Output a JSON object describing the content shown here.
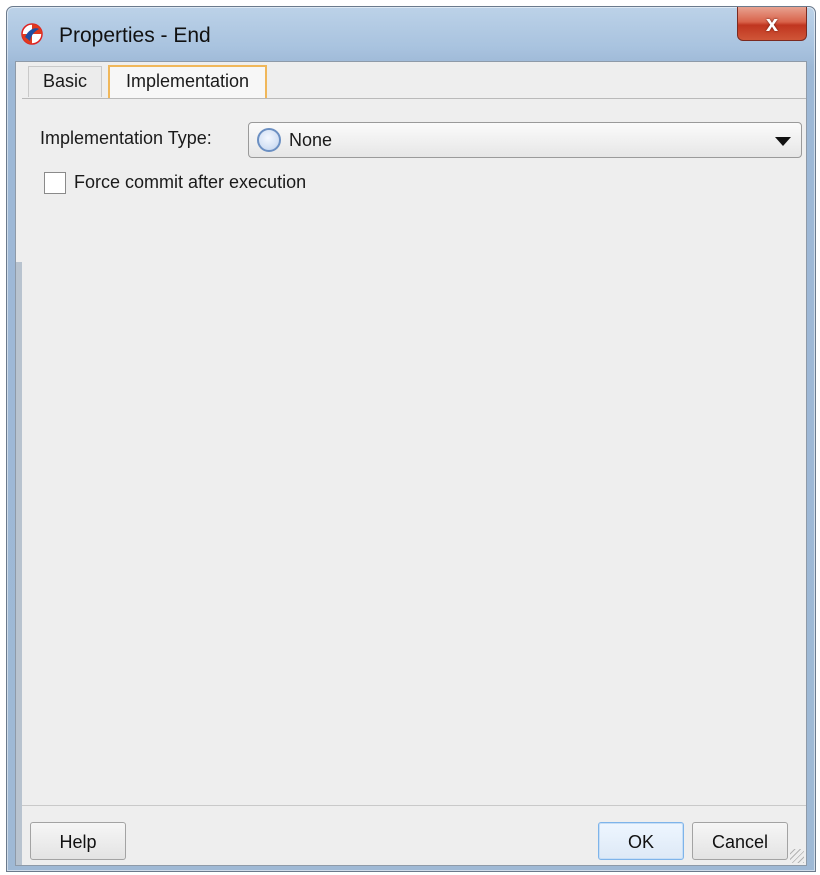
{
  "window": {
    "title": "Properties - End",
    "icon": "oracle-app-icon",
    "close_icon": "close-icon",
    "close_glyph": "x"
  },
  "tabs": [
    {
      "label": "Basic",
      "selected": false
    },
    {
      "label": "Implementation",
      "selected": true
    }
  ],
  "implementation": {
    "type_label": "Implementation Type:",
    "type_value": "None",
    "type_icon": "radio-icon",
    "force_commit_label": "Force commit after execution",
    "force_commit_checked": false
  },
  "buttons": {
    "help": "Help",
    "ok": "OK",
    "cancel": "Cancel"
  },
  "colors": {
    "tab_selected_border": "#f0b75a",
    "close_button": "#c0351f",
    "default_button_border": "#7eb4ea"
  }
}
